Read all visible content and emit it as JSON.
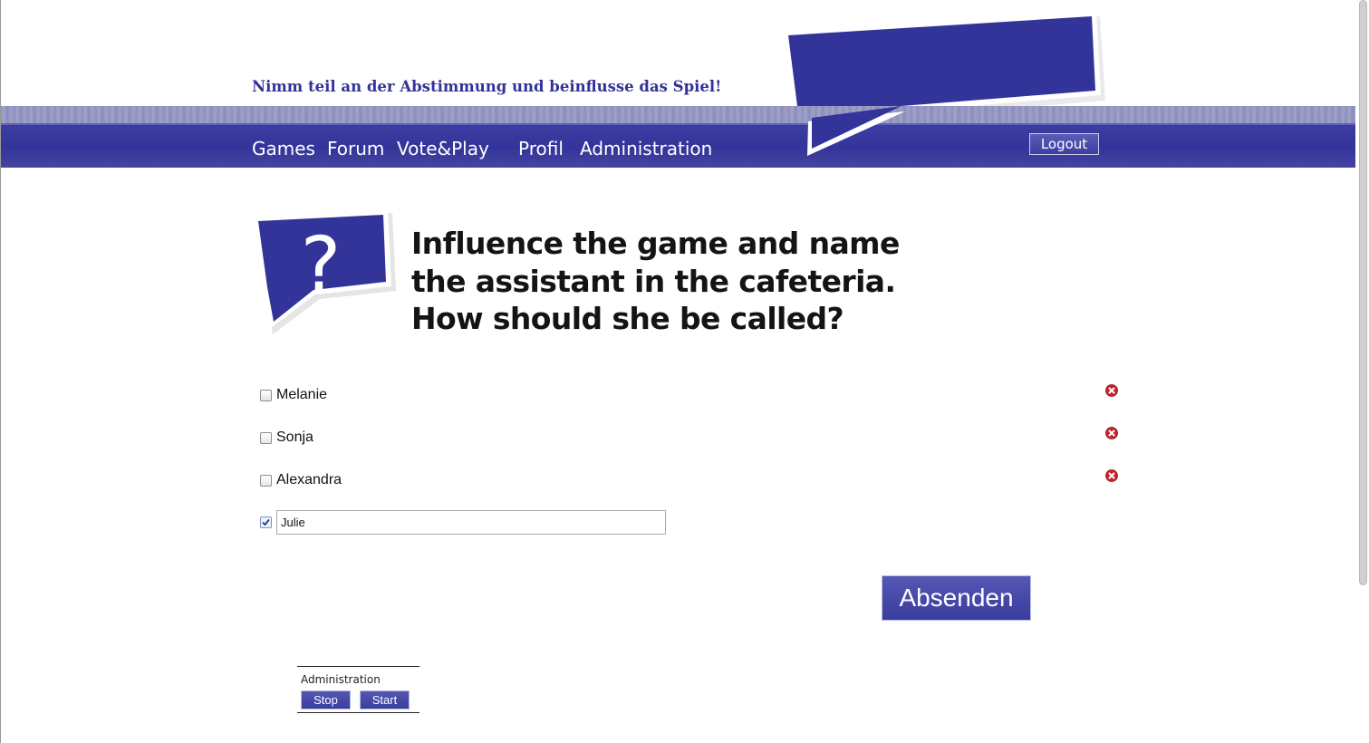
{
  "header": {
    "tagline": "Nimm teil an der Abstimmung und beinflusse das Spiel!",
    "logout_label": "Logout",
    "brand_color": "#33349a"
  },
  "nav": [
    {
      "label": "Games"
    },
    {
      "label": "Forum"
    },
    {
      "label": "Vote&Play"
    },
    {
      "label": "Profil"
    },
    {
      "label": "Administration"
    }
  ],
  "question": {
    "icon": "question-mark-bubble-icon",
    "glyph": "?",
    "lines": [
      "Influence the game and name",
      "the assistant in the cafeteria.",
      "How should she be called?"
    ]
  },
  "options": [
    {
      "label": "Melanie",
      "checked": false
    },
    {
      "label": "Sonja",
      "checked": false
    },
    {
      "label": "Alexandra",
      "checked": false
    }
  ],
  "new_option": {
    "value": "Julie",
    "checked": true
  },
  "submit_label": "Absenden",
  "admin": {
    "title": "Administration",
    "stop_label": "Stop",
    "start_label": "Start"
  }
}
